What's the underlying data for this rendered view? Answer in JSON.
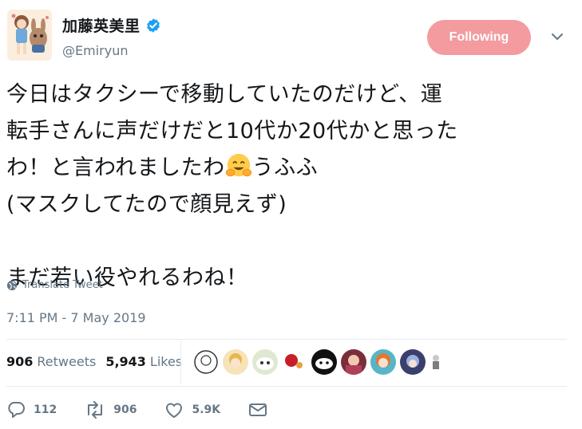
{
  "header": {
    "display_name": "加藤英美里",
    "handle": "@Emiryun",
    "follow_label": "Following",
    "follow_color": "#f39b9f",
    "verified_icon": "verified-badge-icon",
    "menu_icon": "chevron-down-icon"
  },
  "tweet": {
    "lines": [
      "今日はタクシーで移動していたのだけど、運",
      "転手さんに声だけだと10代か20代かと思った",
      "わ！と言われましたわ",
      "うふふ",
      "(マスクしてたので顔見えず)",
      "まだ若い役やれるわね！"
    ],
    "emoji": "hugging-face-emoji",
    "translate_label": "Translate Tweet",
    "timestamp": "7:11 PM - 7 May 2019"
  },
  "stats": {
    "retweets_count": "906",
    "retweets_label": "Retweets",
    "likes_count": "5,943",
    "likes_label": "Likes"
  },
  "liker_avatars": [
    "avatar-1",
    "avatar-2",
    "avatar-3",
    "avatar-4",
    "avatar-5",
    "avatar-6",
    "avatar-7",
    "avatar-8",
    "avatar-9"
  ],
  "actions": {
    "reply_count": "112",
    "retweet_count": "906",
    "like_count": "5.9K",
    "dm_icon": "envelope-icon"
  },
  "colors": {
    "text": "#14171a",
    "secondary": "#657786",
    "verified": "#1da1f2",
    "divider": "#e6ecf0"
  }
}
